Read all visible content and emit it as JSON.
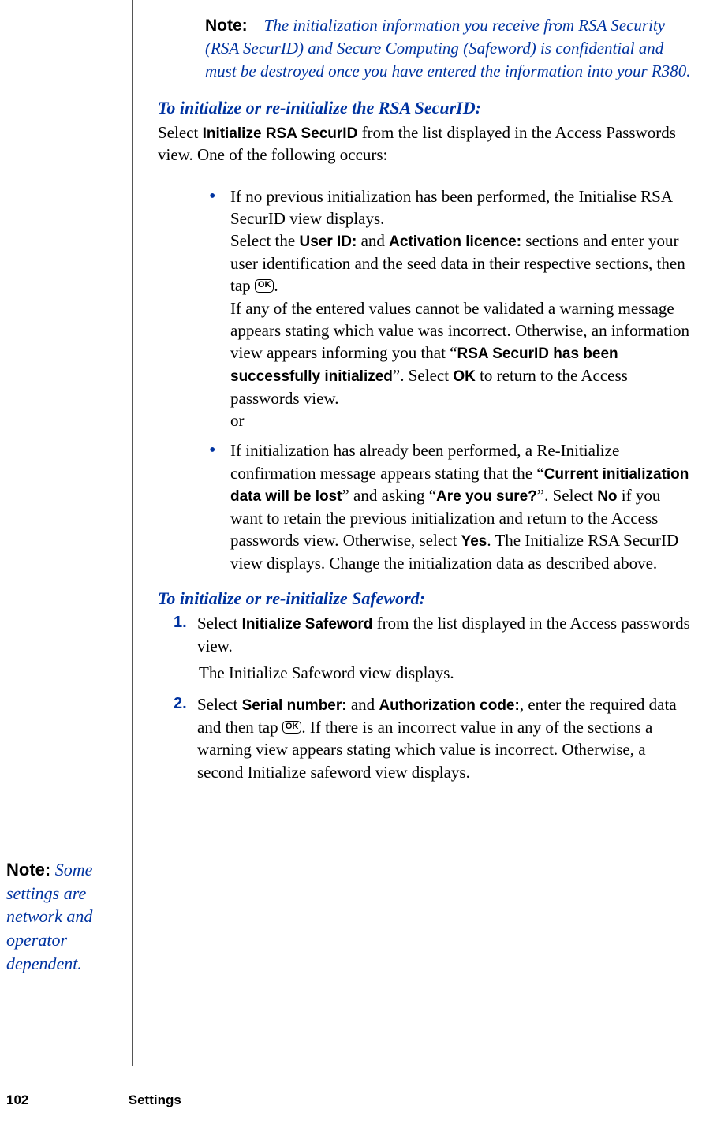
{
  "noteBlock": {
    "label": "Note:",
    "body": "The initialization information you receive from RSA Security (RSA SecurID) and Secure Computing (Safeword) is confidential and must be destroyed once you have entered the information into your R380."
  },
  "heading1": "To initialize or re-initialize the RSA SecurID:",
  "intro1_a": "Select ",
  "intro1_bold": "Initialize RSA SecurID",
  "intro1_b": " from the list displayed in the Access Passwords view. One of the following occurs:",
  "bullets": [
    {
      "p1_a": "If no previous initialization has been performed, the Initialise RSA SecurID view displays.",
      "p2_pre": "Select the ",
      "p2_b1": "User ID:",
      "p2_mid": " and ",
      "p2_b2": "Activation licence:",
      "p2_post": " sections and enter your user identification and the seed data in their respective sections, then tap ",
      "ok": "OK",
      "p2_end": ".",
      "p3_a": "If any of the entered values cannot be validated a warning message appears stating which value was incorrect. Otherwise, an information view appears informing you that “",
      "p3_b1": "RSA SecurID has been successfully initialized",
      "p3_mid": "”. Select ",
      "p3_b2": "OK",
      "p3_end": " to return to the Access passwords view.",
      "p4": "or"
    },
    {
      "p1_a": "If initialization has already been performed, a Re-Initialize confirmation message appears stating that the “",
      "p1_b1": "Current initialization data will be lost",
      "p1_mid": "” and asking “",
      "p1_b2": "Are you sure?",
      "p1_mid2": "”. Select ",
      "p1_b3": "No",
      "p1_mid3": " if you want to retain the previous initialization and return to the Access passwords view. Otherwise, select ",
      "p1_b4": "Yes",
      "p1_end": ". The Initialize RSA SecurID view displays. Change the initialization data as described above."
    }
  ],
  "heading2": "To initialize or re-initialize Safeword:",
  "steps": [
    {
      "num": "1.",
      "a": "Select ",
      "b1": "Initialize Safeword",
      "b": " from the list displayed in the Access passwords view.",
      "sub": "The Initialize Safeword view displays."
    },
    {
      "num": "2.",
      "a": "Select ",
      "b1": "Serial number:",
      "mid": " and ",
      "b2": "Authorization code:",
      "b": ", enter the required data and then tap ",
      "ok": "OK",
      "c": ". If there is an incorrect value in any of the sections a warning view appears stating which value is incorrect. Otherwise, a second Initialize safeword view displays."
    }
  ],
  "sideNote": {
    "label": "Note:",
    "body": "Some settings are network and operator dependent."
  },
  "footer": {
    "page": "102",
    "section": "Settings"
  }
}
